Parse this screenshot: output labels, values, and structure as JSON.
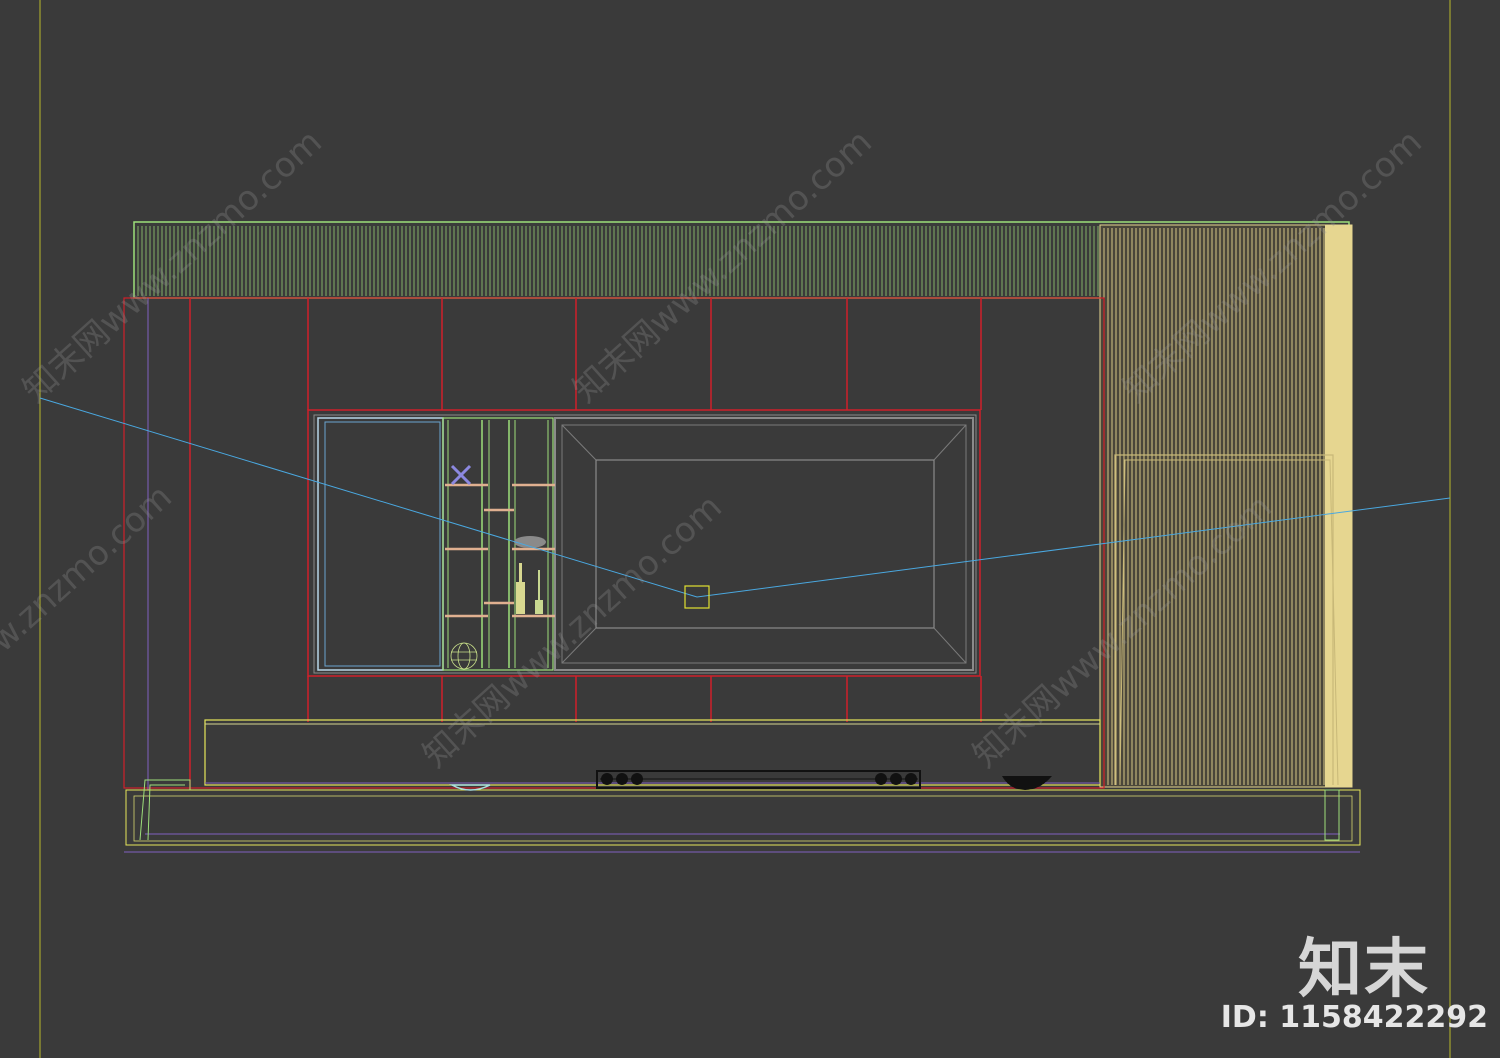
{
  "viewport": {
    "name": "3ds Max front viewport (wireframe)",
    "background": "#3a3a3a",
    "frame_color": "#c8c830"
  },
  "colors": {
    "soffit": "#9ddf7a",
    "slat_panel": "#e6d690",
    "slat_fill": "#d8c98a",
    "red_lines": "#d0202a",
    "tv_frame": "#8a8a8a",
    "shelf": "#c9e08a",
    "cabinet_outline": "#e6e65a",
    "purple_lines": "#8060c0",
    "camera_line": "#4aa8e0",
    "camera_target": "#e0e030",
    "appliance": "#111111"
  },
  "watermark": {
    "text": "知末网www.znzmo.com"
  },
  "logo": {
    "text": "知末"
  },
  "id_label": "ID: 1158422292"
}
